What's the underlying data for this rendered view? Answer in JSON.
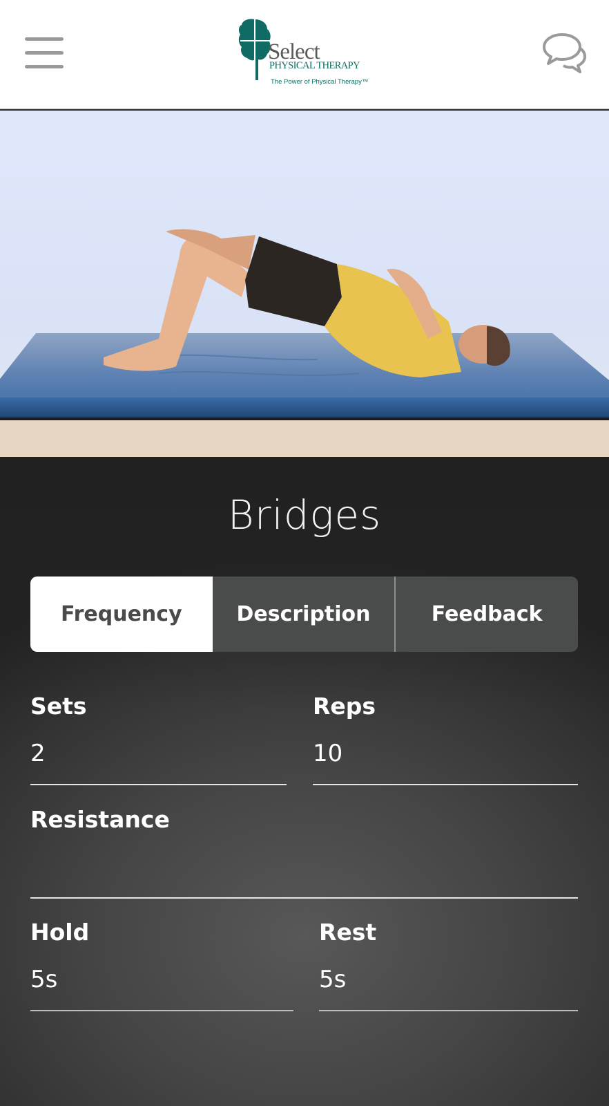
{
  "header": {
    "menu_icon": "hamburger-menu-icon",
    "logo": {
      "brand": "Select",
      "subtitle": "PHYSICAL THERAPY",
      "tagline": "The Power of Physical Therapy™",
      "brand_color": "#0f6b64"
    },
    "chat_icon": "chat-bubbles-icon"
  },
  "video": {
    "description": "Man in yellow shirt and black shorts performing a bridge exercise on a blue mat"
  },
  "exercise": {
    "title": "Bridges"
  },
  "tabs": [
    {
      "label": "Frequency",
      "active": true
    },
    {
      "label": "Description",
      "active": false
    },
    {
      "label": "Feedback",
      "active": false
    }
  ],
  "fields": {
    "sets": {
      "label": "Sets",
      "value": "2"
    },
    "reps": {
      "label": "Reps",
      "value": "10"
    },
    "resistance": {
      "label": "Resistance",
      "value": ""
    },
    "hold": {
      "label": "Hold",
      "value": "5s"
    },
    "rest": {
      "label": "Rest",
      "value": "5s"
    }
  },
  "colors": {
    "active_tab_bg": "#ffffff",
    "inactive_tab_bg": "#4a4b4b",
    "panel_bg": "#3a3a3a",
    "text": "#ffffff"
  }
}
